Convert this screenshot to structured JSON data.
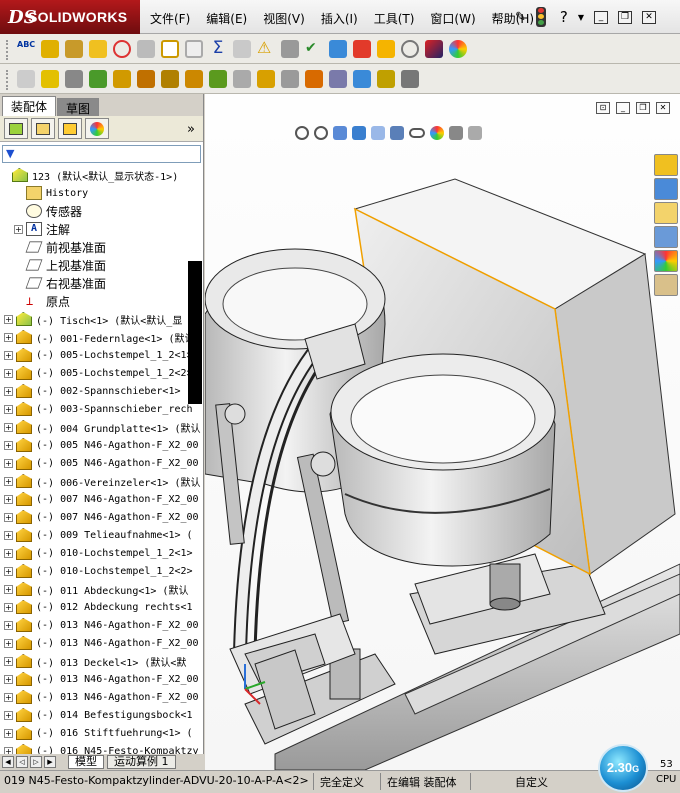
{
  "app": {
    "brand_ds": "DS",
    "brand_name": "SOLIDWORKS"
  },
  "menu": [
    "文件(F)",
    "编辑(E)",
    "视图(V)",
    "插入(I)",
    "工具(T)",
    "窗口(W)",
    "帮助(H)"
  ],
  "help_glyph": "?",
  "panel_tabs": {
    "assembly": "装配体",
    "sketch": "草图"
  },
  "filter_glyph": "▼",
  "tree": {
    "root": "123  (默认<默认_显示状态-1>)",
    "fixed": [
      {
        "label": "History",
        "icon": "history-folder-icon"
      },
      {
        "label": "传感器",
        "icon": "sensor-icon"
      },
      {
        "label": "注解",
        "icon": "annotation-icon"
      },
      {
        "label": "前视基准面",
        "icon": "plane-icon"
      },
      {
        "label": "上视基准面",
        "icon": "plane-icon"
      },
      {
        "label": "右视基准面",
        "icon": "plane-icon"
      },
      {
        "label": "原点",
        "icon": "origin-icon"
      }
    ],
    "components": [
      "(-) Tisch<1> (默认<默认_显",
      "(-) 001-Federnlage<1> (默认",
      "(-) 005-Lochstempel_1_2<1>",
      "(-) 005-Lochstempel_1_2<2>",
      "(-) 002-Spannschieber<1> (",
      "(-) 003-Spannschieber_rech",
      "(-) 004 Grundplatte<1> (默认",
      "(-) 005 N46-Agathon-F_X2_00",
      "(-) 005 N46-Agathon-F_X2_00",
      "(-) 006-Vereinzeler<1> (默认",
      "(-) 007 N46-Agathon-F_X2_00",
      "(-) 007 N46-Agathon-F_X2_00",
      "(-) 009 Telieaufnahme<1> (",
      "(-) 010-Lochstempel_1_2<1>",
      "(-) 010-Lochstempel_1_2<2>",
      "(-) 011 Abdeckung<1> (默认",
      "(-) 012 Abdeckung rechts<1",
      "(-) 013 N46-Agathon-F_X2_00",
      "(-) 013 N46-Agathon-F_X2_00",
      "(-) 013 Deckel<1> (默认<默",
      "(-) 013 N46-Agathon-F_X2_00",
      "(-) 013 N46-Agathon-F_X2_00",
      "(-) 014 Befestigungsbock<1",
      "(-) 016 Stiftfuehrung<1> (",
      "(-) 016 N45-Festo-Kompaktzy"
    ]
  },
  "bottom_tabs": [
    "模型",
    "运动算例 1"
  ],
  "status": {
    "component": "019 N45-Festo-Kompaktzylinder-ADVU-20-10-A-P-A<2>",
    "state": "完全定义",
    "mode": "在编辑 装配体",
    "custom": "自定义",
    "perf": "2.30",
    "perf_unit": "G",
    "cpu_label": "CPU",
    "cpu_num": "53"
  },
  "colors": {
    "brand_red": "#a3161a",
    "model_gray": "#dcdcdc",
    "edge_orange": "#f0a000"
  }
}
